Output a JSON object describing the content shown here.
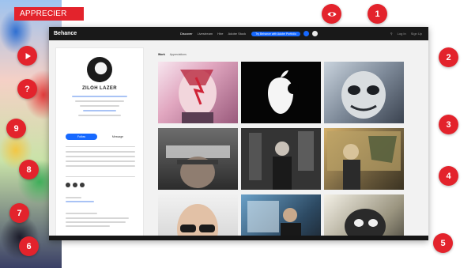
{
  "overlay": {
    "tag_label": "APPRECIER",
    "markers": [
      "1",
      "2",
      "3",
      "4",
      "5",
      "6",
      "7",
      "8",
      "9",
      "?"
    ],
    "accent_color": "#e3232c"
  },
  "browser": {
    "brand": "Behance",
    "nav_links": [
      "Discover",
      "Livestream",
      "Hire",
      "Adobe Stock"
    ],
    "adobe_cta": "Try Behance with Adobe Portfolio",
    "right_links": [
      "Log In",
      "Sign Up"
    ],
    "tabs": [
      "Work",
      "Appreciations"
    ],
    "accent_color": "#1769ff"
  },
  "profile": {
    "name": "ZILOH LAZER",
    "follow_label": "Follow",
    "message_label": "Message"
  },
  "gallery": {
    "tiles": [
      {
        "icon": "bowie-portrait-thumb"
      },
      {
        "icon": "apple-silhouette-thumb"
      },
      {
        "icon": "masked-face-thumb"
      },
      {
        "icon": "graffiti-face-thumb"
      },
      {
        "icon": "man-in-studio-thumb"
      },
      {
        "icon": "artist-with-mural-thumb"
      },
      {
        "icon": "bald-man-sunglasses-thumb"
      },
      {
        "icon": "painter-at-work-thumb"
      },
      {
        "icon": "street-art-thumb"
      }
    ]
  }
}
